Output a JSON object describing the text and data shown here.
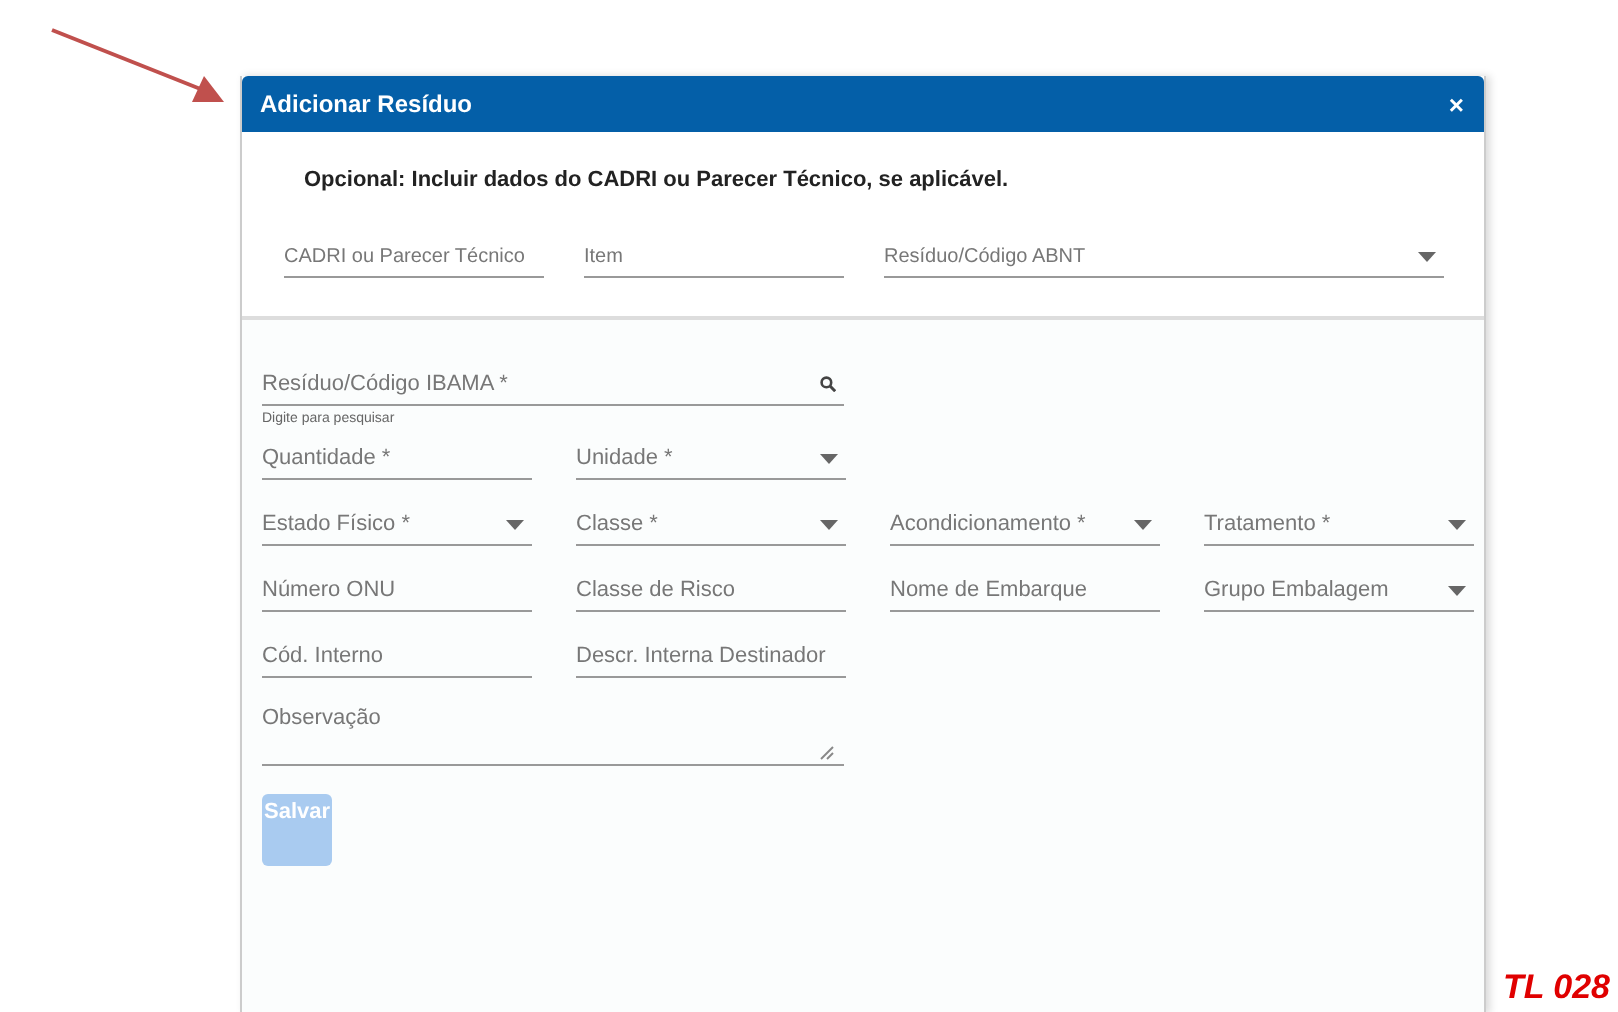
{
  "annotation": {
    "label": "TL 028"
  },
  "dialog": {
    "title": "Adicionar Resíduo",
    "close": "×",
    "note": "Opcional: Incluir dados do CADRI ou Parecer Técnico, se aplicável.",
    "optional_fields": [
      {
        "label": "CADRI ou Parecer Técnico",
        "kind": "text"
      },
      {
        "label": "Item",
        "kind": "text"
      },
      {
        "label": "Resíduo/Código ABNT",
        "kind": "select"
      }
    ],
    "rows": [
      [
        {
          "label": "Resíduo/Código IBAMA *",
          "kind": "search",
          "hint": "Digite para pesquisar"
        }
      ],
      [
        {
          "label": "Quantidade *",
          "kind": "text"
        },
        {
          "label": "Unidade *",
          "kind": "select"
        }
      ],
      [
        {
          "label": "Estado Físico *",
          "kind": "select"
        },
        {
          "label": "Classe *",
          "kind": "select"
        },
        {
          "label": "Acondicionamento *",
          "kind": "select"
        },
        {
          "label": "Tratamento *",
          "kind": "select"
        }
      ],
      [
        {
          "label": "Número ONU",
          "kind": "text"
        },
        {
          "label": "Classe de Risco",
          "kind": "text"
        },
        {
          "label": "Nome de Embarque",
          "kind": "text"
        },
        {
          "label": "Grupo Embalagem",
          "kind": "select"
        }
      ],
      [
        {
          "label": "Cód. Interno",
          "kind": "text"
        },
        {
          "label": "Descr. Interna Destinador",
          "kind": "text"
        }
      ],
      [
        {
          "label": "Observação",
          "kind": "textarea"
        }
      ]
    ],
    "save_button": {
      "label": "Salvar",
      "disabled": true
    }
  }
}
